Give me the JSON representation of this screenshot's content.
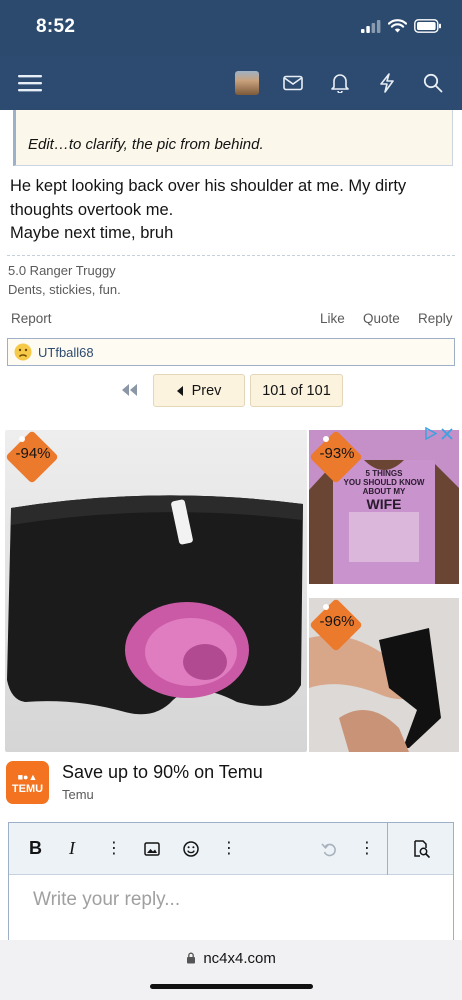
{
  "status": {
    "time": "8:52"
  },
  "nav": {
    "icons": [
      "menu-icon",
      "mail-icon",
      "bell-icon",
      "lightning-icon",
      "search-icon"
    ]
  },
  "post": {
    "quote_text": "Edit…to clarify, the pic from behind.",
    "body_line1": "He kept looking back over his shoulder at me. My dirty",
    "body_line2": "thoughts overtook me.",
    "body_line3": "Maybe next time, bruh",
    "signature_line1": "5.0 Ranger Truggy",
    "signature_line2": "Dents, stickies, fun.",
    "actions": {
      "report": "Report",
      "like": "Like",
      "quote": "Quote",
      "reply": "Reply"
    },
    "reaction_user": "UTfball68"
  },
  "pager": {
    "prev_label": "Prev",
    "page_label": "101 of 101"
  },
  "ad": {
    "discounts": [
      "-94%",
      "-93%",
      "-96%"
    ],
    "shirt_text_1": "5 THINGS",
    "shirt_text_2": "YOU SHOULD KNOW",
    "shirt_text_3": "ABOUT MY",
    "shirt_text_4": "WIFE",
    "logo_text": "TEMU",
    "headline": "Save up to 90% on Temu",
    "brand": "Temu"
  },
  "editor": {
    "placeholder": "Write your reply..."
  },
  "browser": {
    "url": "nc4x4.com"
  },
  "colors": {
    "header": "#2d4b70",
    "badge": "#ec7a2c",
    "temu": "#f37321"
  }
}
